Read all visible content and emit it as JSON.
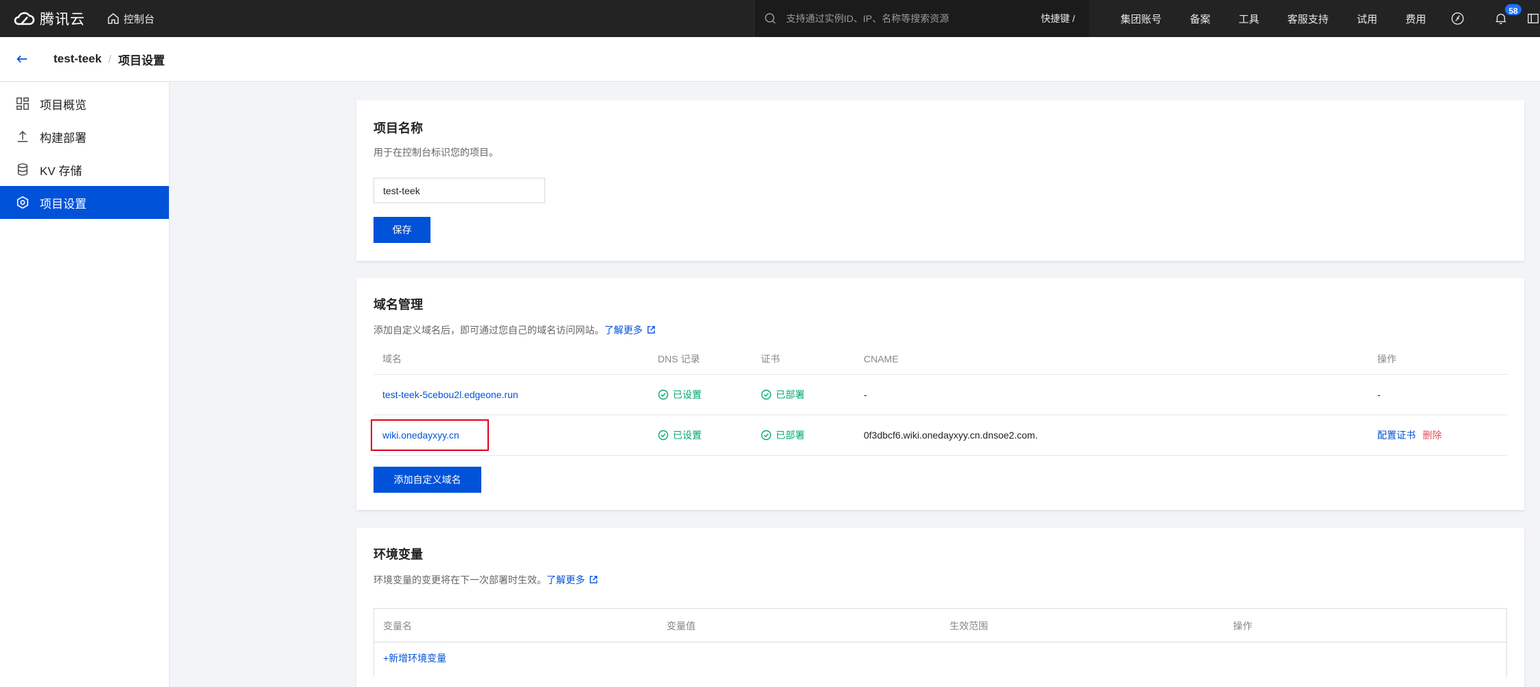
{
  "topbar": {
    "brand": "腾讯云",
    "console": "控制台",
    "search_placeholder": "支持通过实例ID、IP、名称等搜索资源",
    "shortcut": "快捷键 /",
    "nav": [
      "集团账号",
      "备案",
      "工具",
      "客服支持",
      "试用",
      "费用"
    ],
    "notification_count": "58",
    "brand_color": "#0052d9"
  },
  "breadcrumb": {
    "project": "test-teek",
    "separator": "/",
    "page": "项目设置"
  },
  "sidebar": {
    "items": [
      {
        "label": "项目概览",
        "icon": "dashboard-icon"
      },
      {
        "label": "构建部署",
        "icon": "upload-icon"
      },
      {
        "label": "KV 存储",
        "icon": "database-icon"
      },
      {
        "label": "项目设置",
        "icon": "settings-icon",
        "active": true
      }
    ]
  },
  "project_name": {
    "title": "项目名称",
    "desc": "用于在控制台标识您的项目。",
    "input_value": "test-teek",
    "save_label": "保存"
  },
  "domains": {
    "title": "域名管理",
    "desc": "添加自定义域名后，即可通过您自己的域名访问网站。",
    "learn_more": "了解更多",
    "columns": [
      "域名",
      "DNS 记录",
      "证书",
      "CNAME",
      "操作"
    ],
    "rows": [
      {
        "domain": "test-teek-5cebou2l.edgeone.run",
        "dns": "已设置",
        "cert": "已部署",
        "cname": "-",
        "action": "-"
      },
      {
        "domain": "wiki.onedayxyy.cn",
        "dns": "已设置",
        "cert": "已部署",
        "cname": "0f3dbcf6.wiki.onedayxyy.cn.dnsoe2.com.",
        "action_config": "配置证书",
        "action_delete": "删除"
      }
    ],
    "add_label": "添加自定义域名",
    "status_color": "#00a870",
    "danger_color": "#e34d59"
  },
  "env": {
    "title": "环境变量",
    "desc": "环境变量的变更将在下一次部署时生效。",
    "learn_more": "了解更多",
    "columns": [
      "变量名",
      "变量值",
      "生效范围",
      "操作"
    ],
    "add_label": "+新增环境变量"
  }
}
